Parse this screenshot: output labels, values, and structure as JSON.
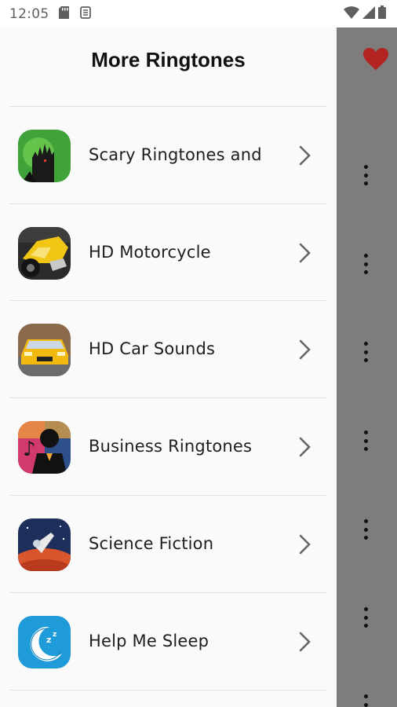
{
  "status_bar": {
    "time": "12:05",
    "left_icons": [
      "sd-card-icon",
      "sync-icon"
    ],
    "right_icons": [
      "wifi-icon",
      "signal-icon",
      "battery-icon"
    ]
  },
  "drawer": {
    "title": "More Ringtones",
    "items": [
      {
        "label": "Scary Ringtones and",
        "icon": "scary-app-icon"
      },
      {
        "label": "HD Motorcycle",
        "icon": "motorcycle-app-icon"
      },
      {
        "label": "HD Car Sounds",
        "icon": "car-app-icon"
      },
      {
        "label": "Business Ringtones",
        "icon": "business-app-icon"
      },
      {
        "label": "Science Fiction",
        "icon": "scifi-app-icon"
      },
      {
        "label": "Help Me Sleep",
        "icon": "sleep-app-icon"
      }
    ]
  },
  "background_page": {
    "icons": [
      "heart-icon",
      "more-vert-icon"
    ],
    "colors": {
      "scrim": "#7d7d7d",
      "heart": "#b3231f"
    }
  }
}
